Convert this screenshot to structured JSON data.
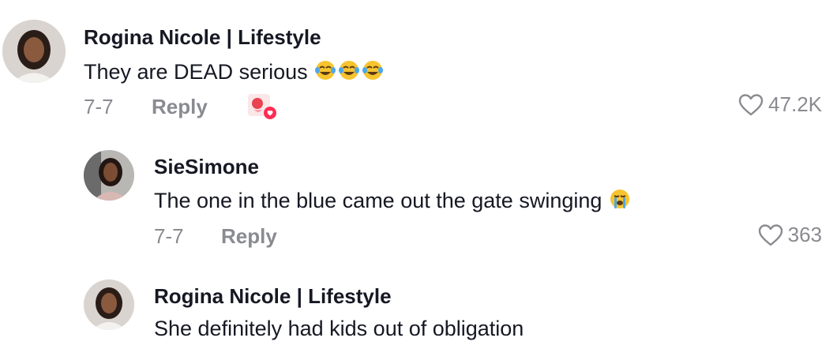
{
  "comments": [
    {
      "author": "Rogina Nicole | Lifestyle",
      "text": "They are DEAD serious",
      "emoji": [
        "face-with-tears-of-joy",
        "face-with-tears-of-joy",
        "face-with-tears-of-joy"
      ],
      "date": "7-7",
      "reply_label": "Reply",
      "likes": "47.2K",
      "liked_by_creator_badge": true
    },
    {
      "author": "SieSimone",
      "text": "The one in the blue came out the gate swinging",
      "emoji": [
        "loudly-crying-face"
      ],
      "date": "7-7",
      "reply_label": "Reply",
      "likes": "363"
    },
    {
      "author": "Rogina Nicole | Lifestyle",
      "text": "She definitely had kids out of obligation"
    }
  ],
  "colors": {
    "text_primary": "#161823",
    "text_secondary": "#8a8b91",
    "creator_badge": "#fe2c55"
  }
}
